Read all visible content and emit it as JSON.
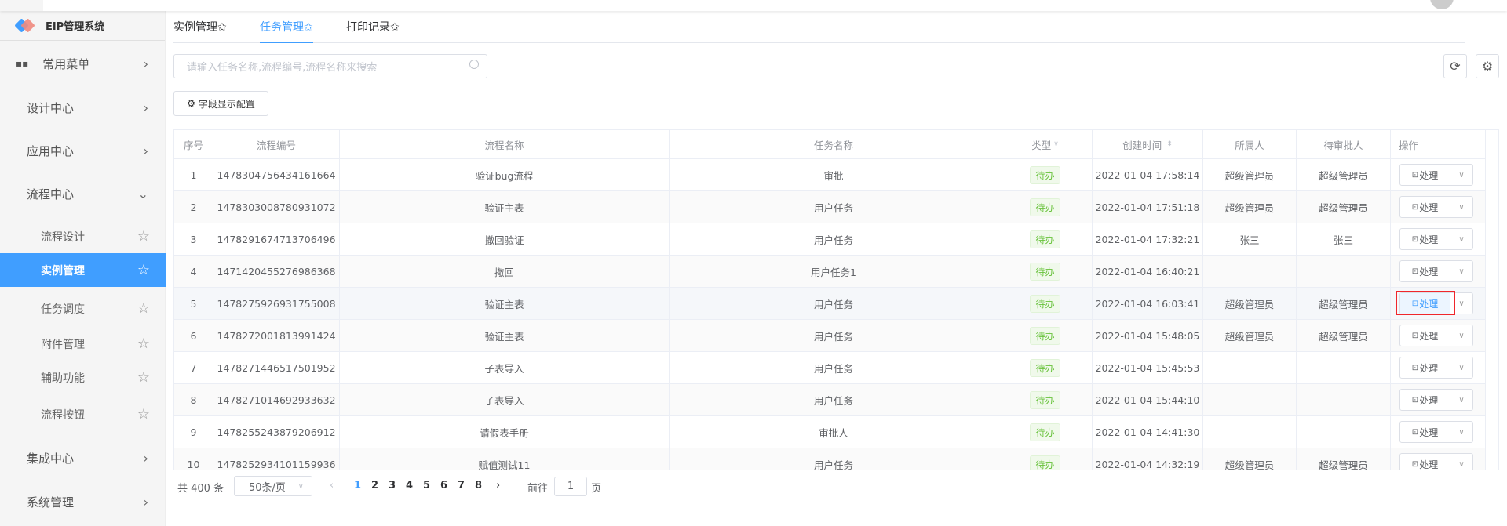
{
  "app": {
    "title": "EIP管理系统"
  },
  "colors": {
    "accent": "#409eff",
    "active_bg": "#409eff",
    "badge_green": "#67c23a",
    "highlight": "#f0262b"
  },
  "sidebar": {
    "top": [
      {
        "label": "常用菜单",
        "icon": "grid-icon"
      },
      {
        "label": "设计中心"
      },
      {
        "label": "应用中心"
      },
      {
        "label": "流程中心",
        "expanded": true
      }
    ],
    "sub": [
      {
        "label": "流程设计"
      },
      {
        "label": "实例管理",
        "active": true
      },
      {
        "label": "任务调度"
      },
      {
        "label": "附件管理"
      },
      {
        "label": "辅助功能"
      },
      {
        "label": "流程按钮"
      }
    ],
    "bottom": [
      {
        "label": "集成中心"
      },
      {
        "label": "系统管理"
      }
    ]
  },
  "tabs": [
    {
      "label": "实例管理✩"
    },
    {
      "label": "任务管理✩",
      "active": true
    },
    {
      "label": "打印记录✩"
    }
  ],
  "search": {
    "placeholder": "请输入任务名称,流程编号,流程名称来搜索",
    "value": ""
  },
  "toolbar": {
    "field_config": "字段显示配置",
    "refresh_icon": "refresh-icon",
    "settings_icon": "gear-icon"
  },
  "table": {
    "columns": [
      "序号",
      "流程编号",
      "流程名称",
      "任务名称",
      "类型",
      "创建时间",
      "所属人",
      "待审批人",
      "操作"
    ],
    "action_label": "处理",
    "rows": [
      [
        "1",
        "1478304756434161664",
        "验证bug流程",
        "审批",
        "待办",
        "2022-01-04 17:58:14",
        "超级管理员",
        "超级管理员"
      ],
      [
        "2",
        "1478303008780931072",
        "验证主表",
        "用户任务",
        "待办",
        "2022-01-04 17:51:18",
        "超级管理员",
        "超级管理员"
      ],
      [
        "3",
        "1478291674713706496",
        "撤回验证",
        "用户任务",
        "待办",
        "2022-01-04 17:32:21",
        "张三",
        "张三"
      ],
      [
        "4",
        "1471420455276986368",
        "撤回",
        "用户任务1",
        "待办",
        "2022-01-04 16:40:21",
        "",
        ""
      ],
      [
        "5",
        "1478275926931755008",
        "验证主表",
        "用户任务",
        "待办",
        "2022-01-04 16:03:41",
        "超级管理员",
        "超级管理员"
      ],
      [
        "6",
        "1478272001813991424",
        "验证主表",
        "用户任务",
        "待办",
        "2022-01-04 15:48:05",
        "超级管理员",
        "超级管理员"
      ],
      [
        "7",
        "1478271446517501952",
        "子表导入",
        "用户任务",
        "待办",
        "2022-01-04 15:45:53",
        "",
        ""
      ],
      [
        "8",
        "1478271014692933632",
        "子表导入",
        "用户任务",
        "待办",
        "2022-01-04 15:44:10",
        "",
        ""
      ],
      [
        "9",
        "1478255243879206912",
        "请假表手册",
        "审批人",
        "待办",
        "2022-01-04 14:41:30",
        "",
        ""
      ],
      [
        "10",
        "1478252934101159936",
        "赋值测试11",
        "用户任务",
        "待办",
        "2022-01-04 14:32:19",
        "超级管理员",
        "超级管理员"
      ]
    ]
  },
  "pagination": {
    "total": "共 400 条",
    "page_size": "50条/页",
    "pages": [
      "1",
      "2",
      "3",
      "4",
      "5",
      "6",
      "7",
      "8"
    ],
    "current": "1",
    "goto_label": "前往",
    "goto_value": "1",
    "page_suffix": "页"
  }
}
